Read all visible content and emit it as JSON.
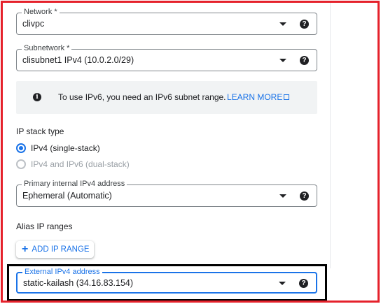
{
  "network": {
    "label": "Network *",
    "value": "clivpc"
  },
  "subnetwork": {
    "label": "Subnetwork *",
    "value": "clisubnet1 IPv4 (10.0.2.0/29)"
  },
  "ipv6_notice": {
    "text": "To use IPv6, you need an IPv6 subnet range.",
    "link_label": "LEARN MORE"
  },
  "ip_stack": {
    "title": "IP stack type",
    "options": [
      {
        "label": "IPv4 (single-stack)",
        "selected": true,
        "enabled": true
      },
      {
        "label": "IPv4 and IPv6 (dual-stack)",
        "selected": false,
        "enabled": false
      }
    ]
  },
  "primary_ipv4": {
    "label": "Primary internal IPv4 address",
    "value": "Ephemeral (Automatic)"
  },
  "alias_ip": {
    "title": "Alias IP ranges",
    "add_button_label": "ADD IP RANGE"
  },
  "external_ipv4": {
    "label": "External IPv4 address",
    "value": "static-kailash (34.16.83.154)"
  },
  "icons": {
    "dropdown": "caret-down-icon",
    "help": "help-icon",
    "info": "info-icon",
    "external_link": "external-link-icon",
    "add": "plus-icon"
  },
  "colors": {
    "accent": "#1a73e8",
    "highlight_frame": "#e5212b",
    "focus_frame": "#000000"
  }
}
